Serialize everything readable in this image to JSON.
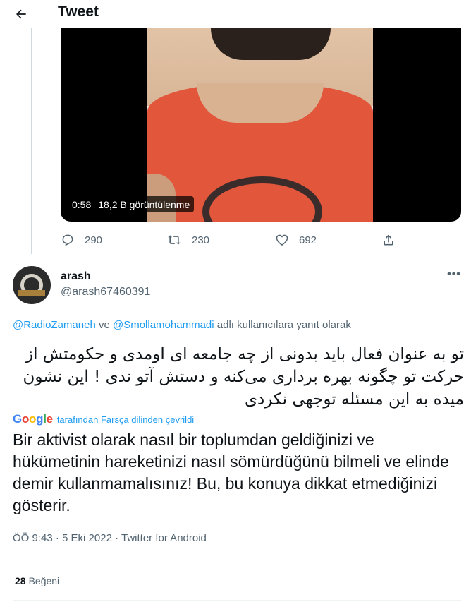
{
  "header": {
    "title": "Tweet",
    "back_icon": "arrow-left-icon"
  },
  "previous_tweet": {
    "video": {
      "duration": "0:58",
      "views": "18,2 B görüntülenme"
    },
    "actions": [
      {
        "name": "reply",
        "icon": "reply-icon",
        "count": "290"
      },
      {
        "name": "retweet",
        "icon": "retweet-icon",
        "count": "230"
      },
      {
        "name": "like",
        "icon": "heart-icon",
        "count": "692"
      },
      {
        "name": "share",
        "icon": "share-icon",
        "count": ""
      }
    ]
  },
  "tweet": {
    "author": {
      "name": "arash",
      "handle": "@arash67460391"
    },
    "more_icon": "more-icon",
    "reply_to": {
      "mention1": "@RadioZamaneh",
      "connector": " ve ",
      "mention2": "@Smollamohammadi",
      "suffix": " adlı kullanıcılara yanıt olarak"
    },
    "text_original": "تو به عنوان فعال باید بدونی از چه جامعه ای اومدی و حکومتش از حرکت تو چگونه بهره برداری می‌کنه و دستش آتو ندی ! این نشون میده به این مسئله توجهی نکردی",
    "translation_label": "tarafından Farsça dilinden çevrildi",
    "google_logo": "Google",
    "text_translated": "Bir aktivist olarak nasıl bir toplumdan geldiğinizi ve hükümetinin hareketinizi nasıl sömürdüğünü bilmeli ve elinde demir kullanmamalısınız! Bu, bu konuya dikkat etmediğinizi gösterir.",
    "meta": {
      "time": "ÖÖ 9:43",
      "separator1": " · ",
      "date": "5 Eki 2022",
      "separator2": " · ",
      "source": "Twitter for Android"
    },
    "likes": {
      "count": "28",
      "label": "Beğeni"
    }
  },
  "colors": {
    "accent": "#1d9bf0",
    "text": "#0f1419",
    "muted": "#536471",
    "border": "#eff3f4"
  }
}
